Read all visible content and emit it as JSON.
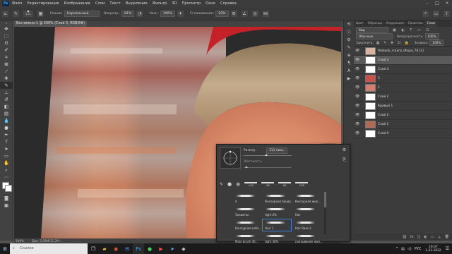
{
  "app": {
    "logo": "Ps"
  },
  "menu": [
    "Файл",
    "Редактирование",
    "Изображение",
    "Слои",
    "Текст",
    "Выделение",
    "Фильтр",
    "3D",
    "Просмотр",
    "Окно",
    "Справка"
  ],
  "options": {
    "mode_label": "Режим:",
    "mode_value": "Нормальный",
    "opacity_label": "Непрозр.:",
    "opacity_value": "81%",
    "flow_label": "Наж.:",
    "flow_value": "100%",
    "smoothing_label": "Сглаживание:",
    "smoothing_value": "10%",
    "brush_size": "111"
  },
  "document": {
    "tab_title": "Без имени-1 @ 500% (Слой 3, RGB/8#)",
    "zoom": "500%",
    "doc_info": "Док: 2,94M/11,2M"
  },
  "panel": {
    "tabs": [
      "Цвет",
      "Образцы",
      "Коррекция",
      "Свойства",
      "Слои"
    ],
    "search_kind": "Вид",
    "blend_mode": "Обычные",
    "opacity_label": "Непрозрачность:",
    "opacity_value": "100%",
    "lock_label": "Закрепить:",
    "fill_label": "Заливка:",
    "fill_value": "100%",
    "layers": [
      {
        "name": "thebank_rcaanz_dhopa_78 [2]",
        "selected": false
      },
      {
        "name": "Слой 3",
        "selected": true
      },
      {
        "name": "Слой 4",
        "selected": false
      },
      {
        "name": "3",
        "selected": false
      },
      {
        "name": "1",
        "selected": false
      },
      {
        "name": "Слой 2",
        "selected": false
      },
      {
        "name": "Кривые 1",
        "selected": false
      },
      {
        "name": "Слой 2",
        "selected": false
      },
      {
        "name": "Слой 1",
        "selected": false
      },
      {
        "name": "Слой 0",
        "selected": false
      }
    ]
  },
  "brush_popup": {
    "size_label": "Размер:",
    "size_value": "111 пикс.",
    "hardness_label": "Жесткость:",
    "hardness_value": "",
    "recent_sizes": [
      "149",
      "56",
      "84",
      "226"
    ],
    "presets": [
      {
        "name": "4"
      },
      {
        "name": "Контурная банда"
      },
      {
        "name": "Контурная жил..."
      },
      {
        "name": "Заливтак"
      },
      {
        "name": "light 0%"
      },
      {
        "name": "Hair"
      },
      {
        "name": "Контурная соба..."
      },
      {
        "name": "Hair 1"
      },
      {
        "name": "Hair Base 2"
      },
      {
        "name": "Mule brush 30..."
      },
      {
        "name": "light 40%"
      },
      {
        "name": "смазывание жал..."
      }
    ]
  },
  "taskbar": {
    "search_placeholder": "Ссылки",
    "lang": "РУС",
    "time": "19:07",
    "date": "1.03.2022"
  },
  "colors": {
    "accent": "#31a8ff",
    "selection": "#3d7fd6",
    "bg": "#535353"
  }
}
